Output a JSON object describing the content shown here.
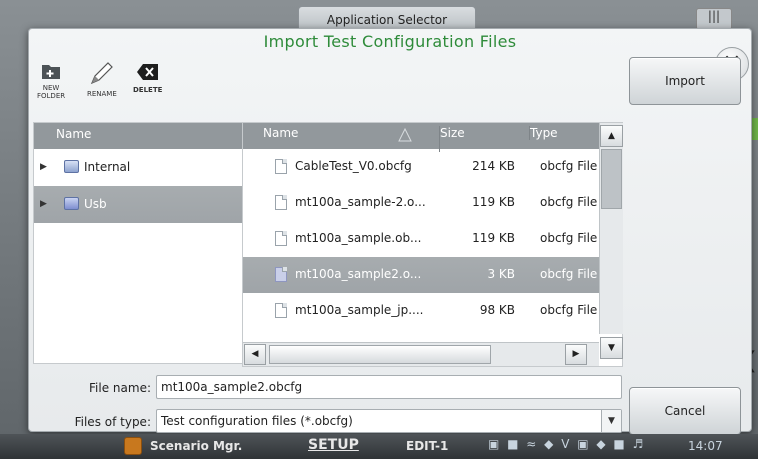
{
  "background": {
    "app_selector_tab": "Application Selector",
    "corner_label": "|||"
  },
  "dialog": {
    "title": "Import Test Configuration Files",
    "close_glyph": "✕",
    "toolbar": {
      "new_folder": "NEW\nFOLDER",
      "rename": "RENAME",
      "delete": "DELETE"
    },
    "import_label": "Import",
    "cancel_label": "Cancel",
    "tree": {
      "header": "Name",
      "items": [
        {
          "label": "Internal",
          "selected": false
        },
        {
          "label": "Usb",
          "selected": true
        }
      ]
    },
    "file_list": {
      "headers": {
        "name": "Name",
        "size": "Size",
        "type": "Type"
      },
      "rows": [
        {
          "name": "CableTest_V0.obcfg",
          "size": "214 KB",
          "type": "obcfg File",
          "selected": false
        },
        {
          "name": "mt100a_sample-2.o...",
          "size": "119 KB",
          "type": "obcfg File",
          "selected": false
        },
        {
          "name": "mt100a_sample.ob...",
          "size": "119 KB",
          "type": "obcfg File",
          "selected": false
        },
        {
          "name": "mt100a_sample2.o...",
          "size": "3 KB",
          "type": "obcfg File",
          "selected": true
        },
        {
          "name": "mt100a_sample_jp....",
          "size": "98 KB",
          "type": "obcfg File",
          "selected": false
        }
      ]
    },
    "file_name_label": "File name:",
    "file_name_value": "mt100a_sample2.obcfg",
    "file_type_label": "Files of type:",
    "file_type_value": "Test configuration files (*.obcfg)"
  },
  "taskbar": {
    "left_text": "Scenario Mgr.",
    "setup": "SETUP",
    "edit": "EDIT-1",
    "time": "14:07"
  },
  "colors": {
    "title_green": "#2e8b3a",
    "header_gray": "#92989c",
    "selection_gray": "#a3a8ac"
  }
}
